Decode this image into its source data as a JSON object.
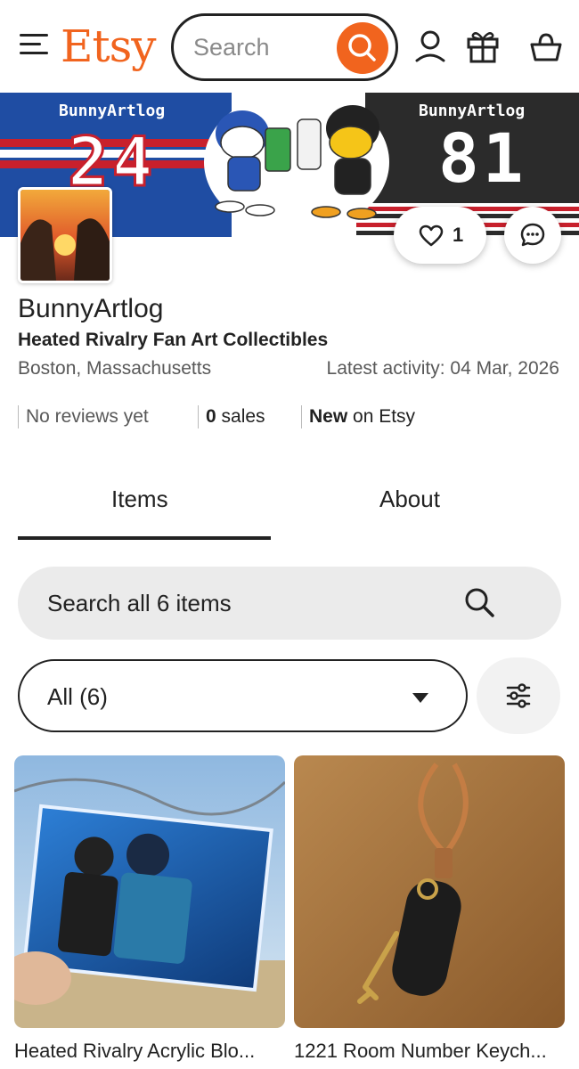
{
  "header": {
    "logo": "Etsy",
    "search_placeholder": "Search"
  },
  "banner": {
    "left_name": "BunnyArtlog",
    "left_number": "24",
    "right_name": "BunnyArtlog",
    "right_number": "81"
  },
  "favorites": {
    "count": "1"
  },
  "shop": {
    "name": "BunnyArtlog",
    "tagline": "Heated Rivalry Fan Art Collectibles",
    "location": "Boston, Massachusetts",
    "latest_activity": "Latest activity: 04 Mar, 2026",
    "stats": {
      "reviews": "No reviews yet",
      "sales_count": "0",
      "sales_label": " sales",
      "new_bold": "New",
      "new_rest": " on Etsy"
    }
  },
  "tabs": [
    {
      "label": "Items",
      "active": true
    },
    {
      "label": "About",
      "active": false
    }
  ],
  "shop_search": {
    "placeholder": "Search all 6 items"
  },
  "filter": {
    "selected": "All (6)"
  },
  "listings": [
    {
      "title": "Heated Rivalry Acrylic Blo..."
    },
    {
      "title": "1221 Room Number Keych..."
    }
  ],
  "colors": {
    "brand_orange": "#f1641e",
    "banner_blue": "#1f4da3",
    "banner_red": "#c8202c",
    "banner_black": "#2b2b2b"
  }
}
